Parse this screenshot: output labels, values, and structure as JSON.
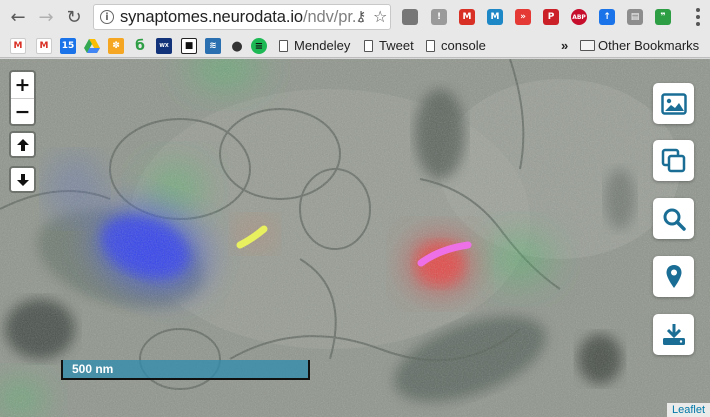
{
  "browser": {
    "url_host": "synaptomes.neurodata.io",
    "url_path": "/ndv/pr...",
    "extensions": [
      {
        "name": "extension-generic-icon",
        "color": "#777777",
        "glyph": ""
      },
      {
        "name": "extension-info-icon",
        "color": "#9a9a9a",
        "glyph": "!"
      },
      {
        "name": "gmail-extension-icon",
        "color": "#d93025",
        "glyph": "M"
      },
      {
        "name": "m-extension-icon",
        "color": "#1e88c7",
        "glyph": "M"
      },
      {
        "name": "red-extension-icon",
        "color": "#e53935",
        "glyph": "»"
      },
      {
        "name": "pinterest-icon",
        "color": "#cb2027",
        "glyph": "P"
      },
      {
        "name": "adblock-plus-icon",
        "color": "#c70d2c",
        "glyph": "ABP"
      },
      {
        "name": "blue-extension-icon",
        "color": "#1a73e8",
        "glyph": "↑"
      },
      {
        "name": "grey-extension-icon",
        "color": "#8d8d8d",
        "glyph": "▤"
      },
      {
        "name": "green-extension-icon",
        "color": "#2e9e45",
        "glyph": "❞"
      }
    ]
  },
  "bookmarks": {
    "items": [
      {
        "label": "Mendeley"
      },
      {
        "label": "Tweet"
      },
      {
        "label": "console"
      }
    ],
    "overflow": "»",
    "other": "Other Bookmarks"
  },
  "map": {
    "zoom_in": "+",
    "zoom_out": "−",
    "scale_label": "500 nm",
    "attribution": "Leaflet",
    "accent_color": "#1a6e95"
  }
}
